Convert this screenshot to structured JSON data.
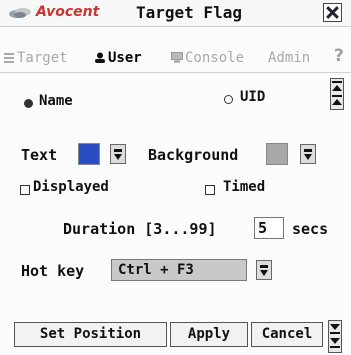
{
  "window": {
    "brand": "Avocent",
    "title": "Target Flag"
  },
  "tabs": [
    {
      "label": "Target",
      "active": false
    },
    {
      "label": "User",
      "active": true
    },
    {
      "label": "Console",
      "active": false
    },
    {
      "label": "Admin",
      "active": false
    }
  ],
  "help_label": "?",
  "mode": {
    "name_label": "Name",
    "uid_label": "UID",
    "selected": "Name"
  },
  "colors": {
    "text_label": "Text",
    "text_color": "#2a4dc4",
    "background_label": "Background",
    "background_color": "#a8a8a8",
    "brand_red": "#cc3333"
  },
  "options": {
    "displayed_label": "Displayed",
    "displayed_checked": false,
    "timed_label": "Timed",
    "timed_checked": false
  },
  "duration": {
    "label": "Duration [3...99]",
    "value": "5",
    "unit": "secs"
  },
  "hotkey": {
    "label": "Hot key",
    "value": "Ctrl + F3"
  },
  "buttons": {
    "set_position": "Set Position",
    "apply": "Apply",
    "cancel": "Cancel"
  }
}
